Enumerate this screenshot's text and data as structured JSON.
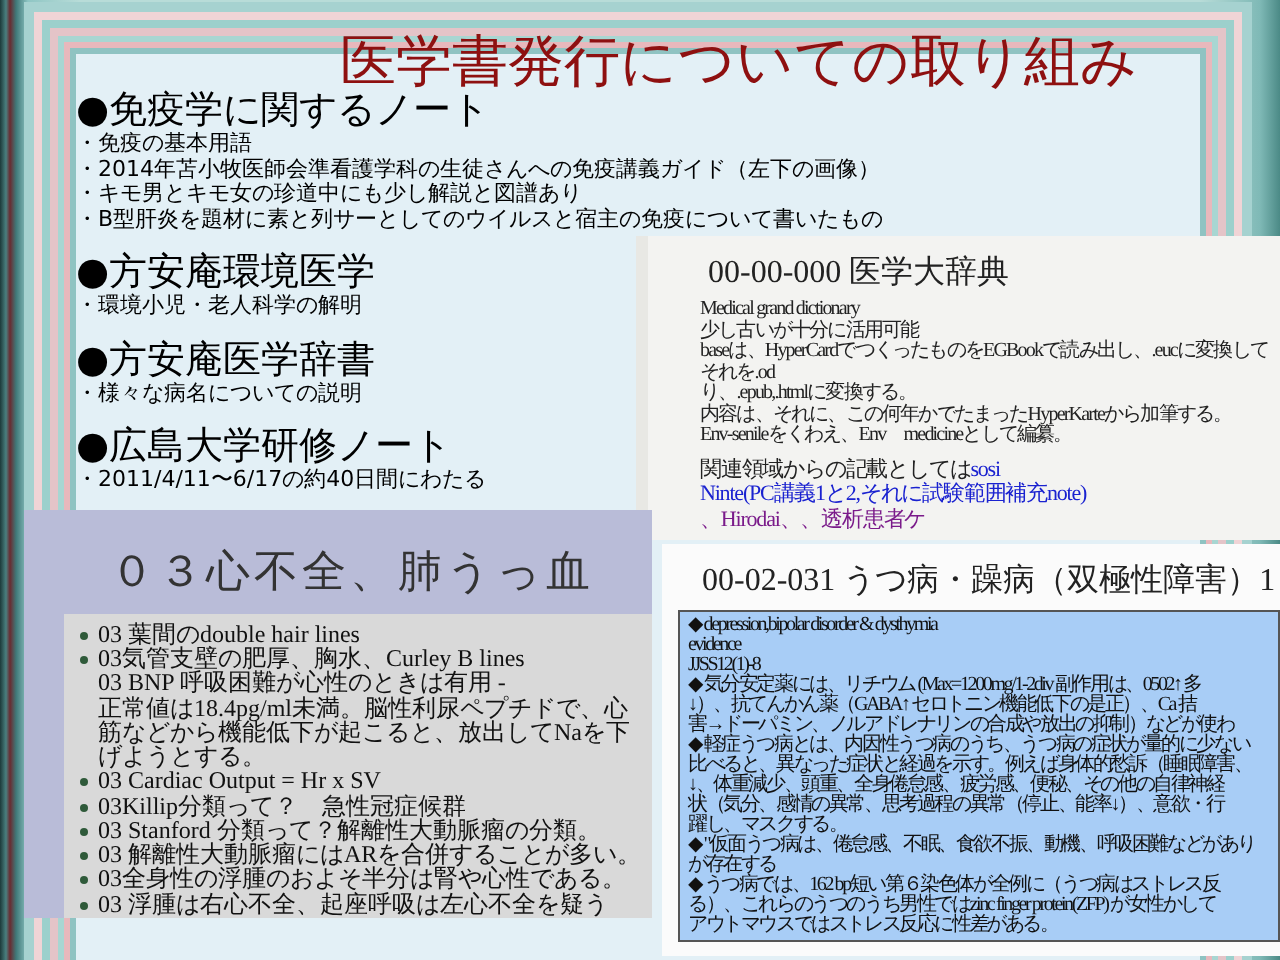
{
  "slide": {
    "title": "医学書発行についての取り組み",
    "sections": [
      {
        "heading": "●免疫学に関するノート",
        "items": [
          "・免疫の基本用語",
          "・2014年苫小牧医師会準看護学科の生徒さんへの免疫講義ガイド（左下の画像）",
          "・キモ男とキモ女の珍道中にも少し解説と図譜あり",
          "・B型肝炎を題材に素と列サーとしてのウイルスと宿主の免疫について書いたもの"
        ]
      },
      {
        "heading": "●方安庵環境医学",
        "items": [
          "・環境小児・老人科学の解明"
        ]
      },
      {
        "heading": "●方安庵医学辞書",
        "items": [
          "・様々な病名についての説明"
        ]
      },
      {
        "heading": "●広島大学研修ノート",
        "items": [
          "・2011/4/11〜6/17の約40日間にわたる"
        ]
      }
    ]
  },
  "insets": [
    {
      "kind": "dictionary",
      "title": "00-00-000 医学大辞典",
      "lines": [
        "Medical grand dictionary",
        "少し古いが十分に活用可能",
        "baseは、HyperCardでつくったものをEGBookで読み出し、.eucに変換してそれを.od",
        "り、.epub,.htmlに変換する。",
        "内容は、それに、この何年かでたまったHyperKarteから加筆する。",
        "Env-senileをくわえ、Env　medicineとして編纂。"
      ],
      "link_lines": [
        [
          {
            "kind": "plain",
            "text": "関連領域からの記載としては"
          },
          {
            "kind": "link",
            "text": "sosi"
          }
        ],
        [
          {
            "kind": "link",
            "text": "Ninte(PC講義1と2,それに試験範囲補充note)"
          },
          {
            "kind": "visited",
            "text": "、Hirodai、、透析患者ケ"
          }
        ]
      ]
    },
    {
      "kind": "lecture",
      "title": "０３心不全、肺うっ血",
      "items": [
        {
          "kind": "bullet",
          "text": "03 葉間のdouble hair lines"
        },
        {
          "kind": "bullet",
          "text": "03気管支壁の肥厚、胸水、Curley B lines"
        },
        {
          "kind": "continuation",
          "text": "03 BNP 呼吸困難が心性のときは有用 -"
        },
        {
          "kind": "continuation",
          "text": "正常値は18.4pg/ml未満。脳性利尿ペプチドで、心筋などから機能低下が起こると、放出してNaを下げようとする。"
        },
        {
          "kind": "bullet",
          "text": "03 Cardiac Output = Hr x SV"
        },
        {
          "kind": "bullet",
          "text": "03Killip分類って？　急性冠症候群"
        },
        {
          "kind": "bullet",
          "text": "03 Stanford 分類って？解離性大動脈瘤の分類。"
        },
        {
          "kind": "bullet",
          "text": "03 解離性大動脈瘤にはARを合併することが多い。"
        },
        {
          "kind": "bullet",
          "text": "03全身性の浮腫のおよそ半分は腎や心性である。"
        },
        {
          "kind": "bullet",
          "text": "03 浮腫は右心不全、起座呼吸は左心不全を疑う"
        }
      ]
    },
    {
      "kind": "article",
      "title": "00-02-031 うつ病・躁病（双極性障害）1",
      "lines": [
        "◆ depression,bipolar disorder & dysthymia",
        "evidence",
        "JJSS12(1)-8",
        "◆ 気分安定薬には、リチウム (Max=1200mg/1-2div 副作用は、0502↑ 多",
        "↓）、抗てんかん薬（GABA↑ セロトニン機能低下の是正）、Ca 拮",
        "害→ドーパミン、ノルアドレナリンの合成や放出の抑制）などが使わ",
        "◆ 軽症うつ病とは、内因性うつ病のうち、うつ病の症状が量的に少ない",
        "比べると、異なった症状と経過を示す。例えば身体的愁訴（睡眠障害、",
        "↓、体重減少、頭重、全身倦怠感、疲労感、便秘、その他の自律神経",
        "状（気分、感情の異常、思考過程の異常（停止、能率↓）、意欲・行",
        "躍し、マスクする。",
        "◆ \"仮面うつ病は、倦怠感、不眠、食欲不振、動機、呼吸困難などがあり",
        "が存在する",
        "◆ うつ病では、162 bp短い第６染色体が全例に（うつ病はストレス反",
        "る）、これらのうつのうち男性ではzinc finger protein(ZFP) が女性かして",
        "アウトマウスではストレス反応に性差がある。"
      ]
    }
  ]
}
